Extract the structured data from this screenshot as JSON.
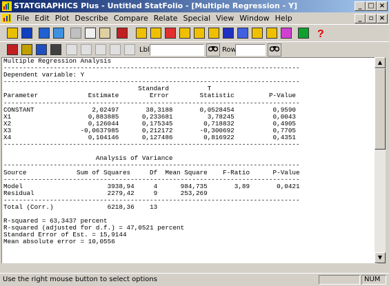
{
  "window": {
    "title": "STATGRAPHICS Plus - Untitled StatFolio - [Multiple Regression - Y]"
  },
  "menu": [
    {
      "label": "File"
    },
    {
      "label": "Edit"
    },
    {
      "label": "Plot"
    },
    {
      "label": "Describe"
    },
    {
      "label": "Compare"
    },
    {
      "label": "Relate"
    },
    {
      "label": "Special"
    },
    {
      "label": "View"
    },
    {
      "label": "Window"
    },
    {
      "label": "Help"
    }
  ],
  "toolbar2": {
    "lbl_label": "Lbl:",
    "row_label": "Row:",
    "lbl_value": "",
    "row_value": ""
  },
  "document": {
    "lines": [
      "Multiple Regression Analysis",
      "-----------------------------------------------------------------------------",
      "Dependent variable: Y",
      "-----------------------------------------------------------------------------",
      "                                   Standard          T",
      "Parameter             Estimate        Error        Statistic         P-Value",
      "-----------------------------------------------------------------------------",
      "CONSTANT               2,02497       38,3188       0,0528454          0,9590",
      "X1                    0,883885      0,233681         3,78245          0,0043",
      "X2                    0,126044      0,175345        0,718832          0,4905",
      "X3                  -0,0637985      0,212172       -0,300692          0,7705",
      "X4                    0,104146      0,127486        0,816922          0,4351",
      "-----------------------------------------------------------------------------",
      "",
      "                        Analysis of Variance",
      "-----------------------------------------------------------------------------",
      "Source             Sum of Squares     Df  Mean Square    F-Ratio      P-Value",
      "-----------------------------------------------------------------------------",
      "Model                      3938,94     4      984,735       3,89       0,0421",
      "Residual                   2279,42     9      253,269",
      "-----------------------------------------------------------------------------",
      "Total (Corr.)              6218,36    13",
      "",
      "R-squared = 63,3437 percent",
      "R-squared (adjusted for d.f.) = 47,0521 percent",
      "Standard Error of Est. = 15,9144",
      "Mean absolute error = 10,0556"
    ]
  },
  "statusbar": {
    "text": "Use the right mouse button to select options",
    "num": "NUM"
  },
  "colors": {
    "title_start": "#0a246a",
    "title_end": "#a6caf0",
    "chrome": "#d4d0c8"
  }
}
